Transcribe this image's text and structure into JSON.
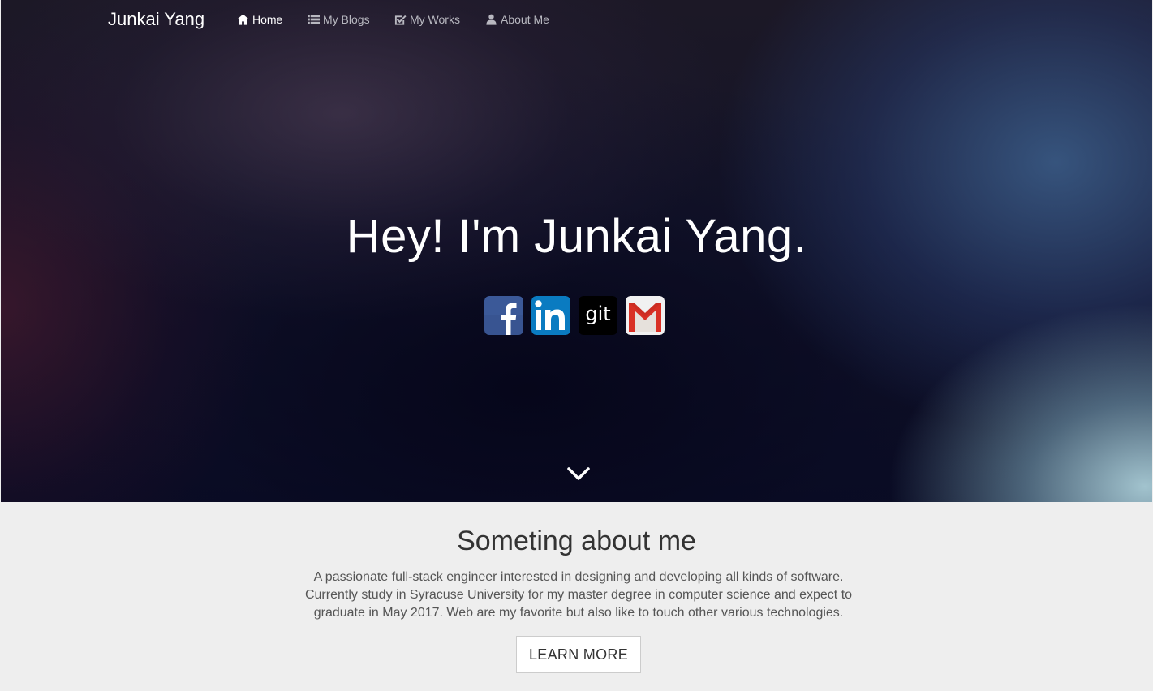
{
  "nav": {
    "brand": "Junkai Yang",
    "items": [
      {
        "label": "Home",
        "icon": "home-icon",
        "active": true
      },
      {
        "label": "My Blogs",
        "icon": "list-icon",
        "active": false
      },
      {
        "label": "My Works",
        "icon": "check-square-icon",
        "active": false
      },
      {
        "label": "About Me",
        "icon": "user-icon",
        "active": false
      }
    ]
  },
  "hero": {
    "title": "Hey! I'm Junkai Yang.",
    "socials": [
      {
        "name": "facebook",
        "icon": "facebook-icon",
        "color": "#3b5998"
      },
      {
        "name": "linkedin",
        "icon": "linkedin-icon",
        "color": "#0077b5"
      },
      {
        "name": "github",
        "icon": "git-icon",
        "color": "#000000",
        "text": "git"
      },
      {
        "name": "gmail",
        "icon": "gmail-icon",
        "color": "#d93025"
      }
    ],
    "scroll_icon": "chevron-down-icon"
  },
  "about": {
    "heading": "Someting about me",
    "body": "A passionate full-stack engineer interested in designing and developing all kinds of software. Currently study in Syracuse University for my master degree in computer science and expect to graduate in May 2017. Web are my favorite but also like to touch other various technologies.",
    "button_label": "LEARN MORE"
  }
}
